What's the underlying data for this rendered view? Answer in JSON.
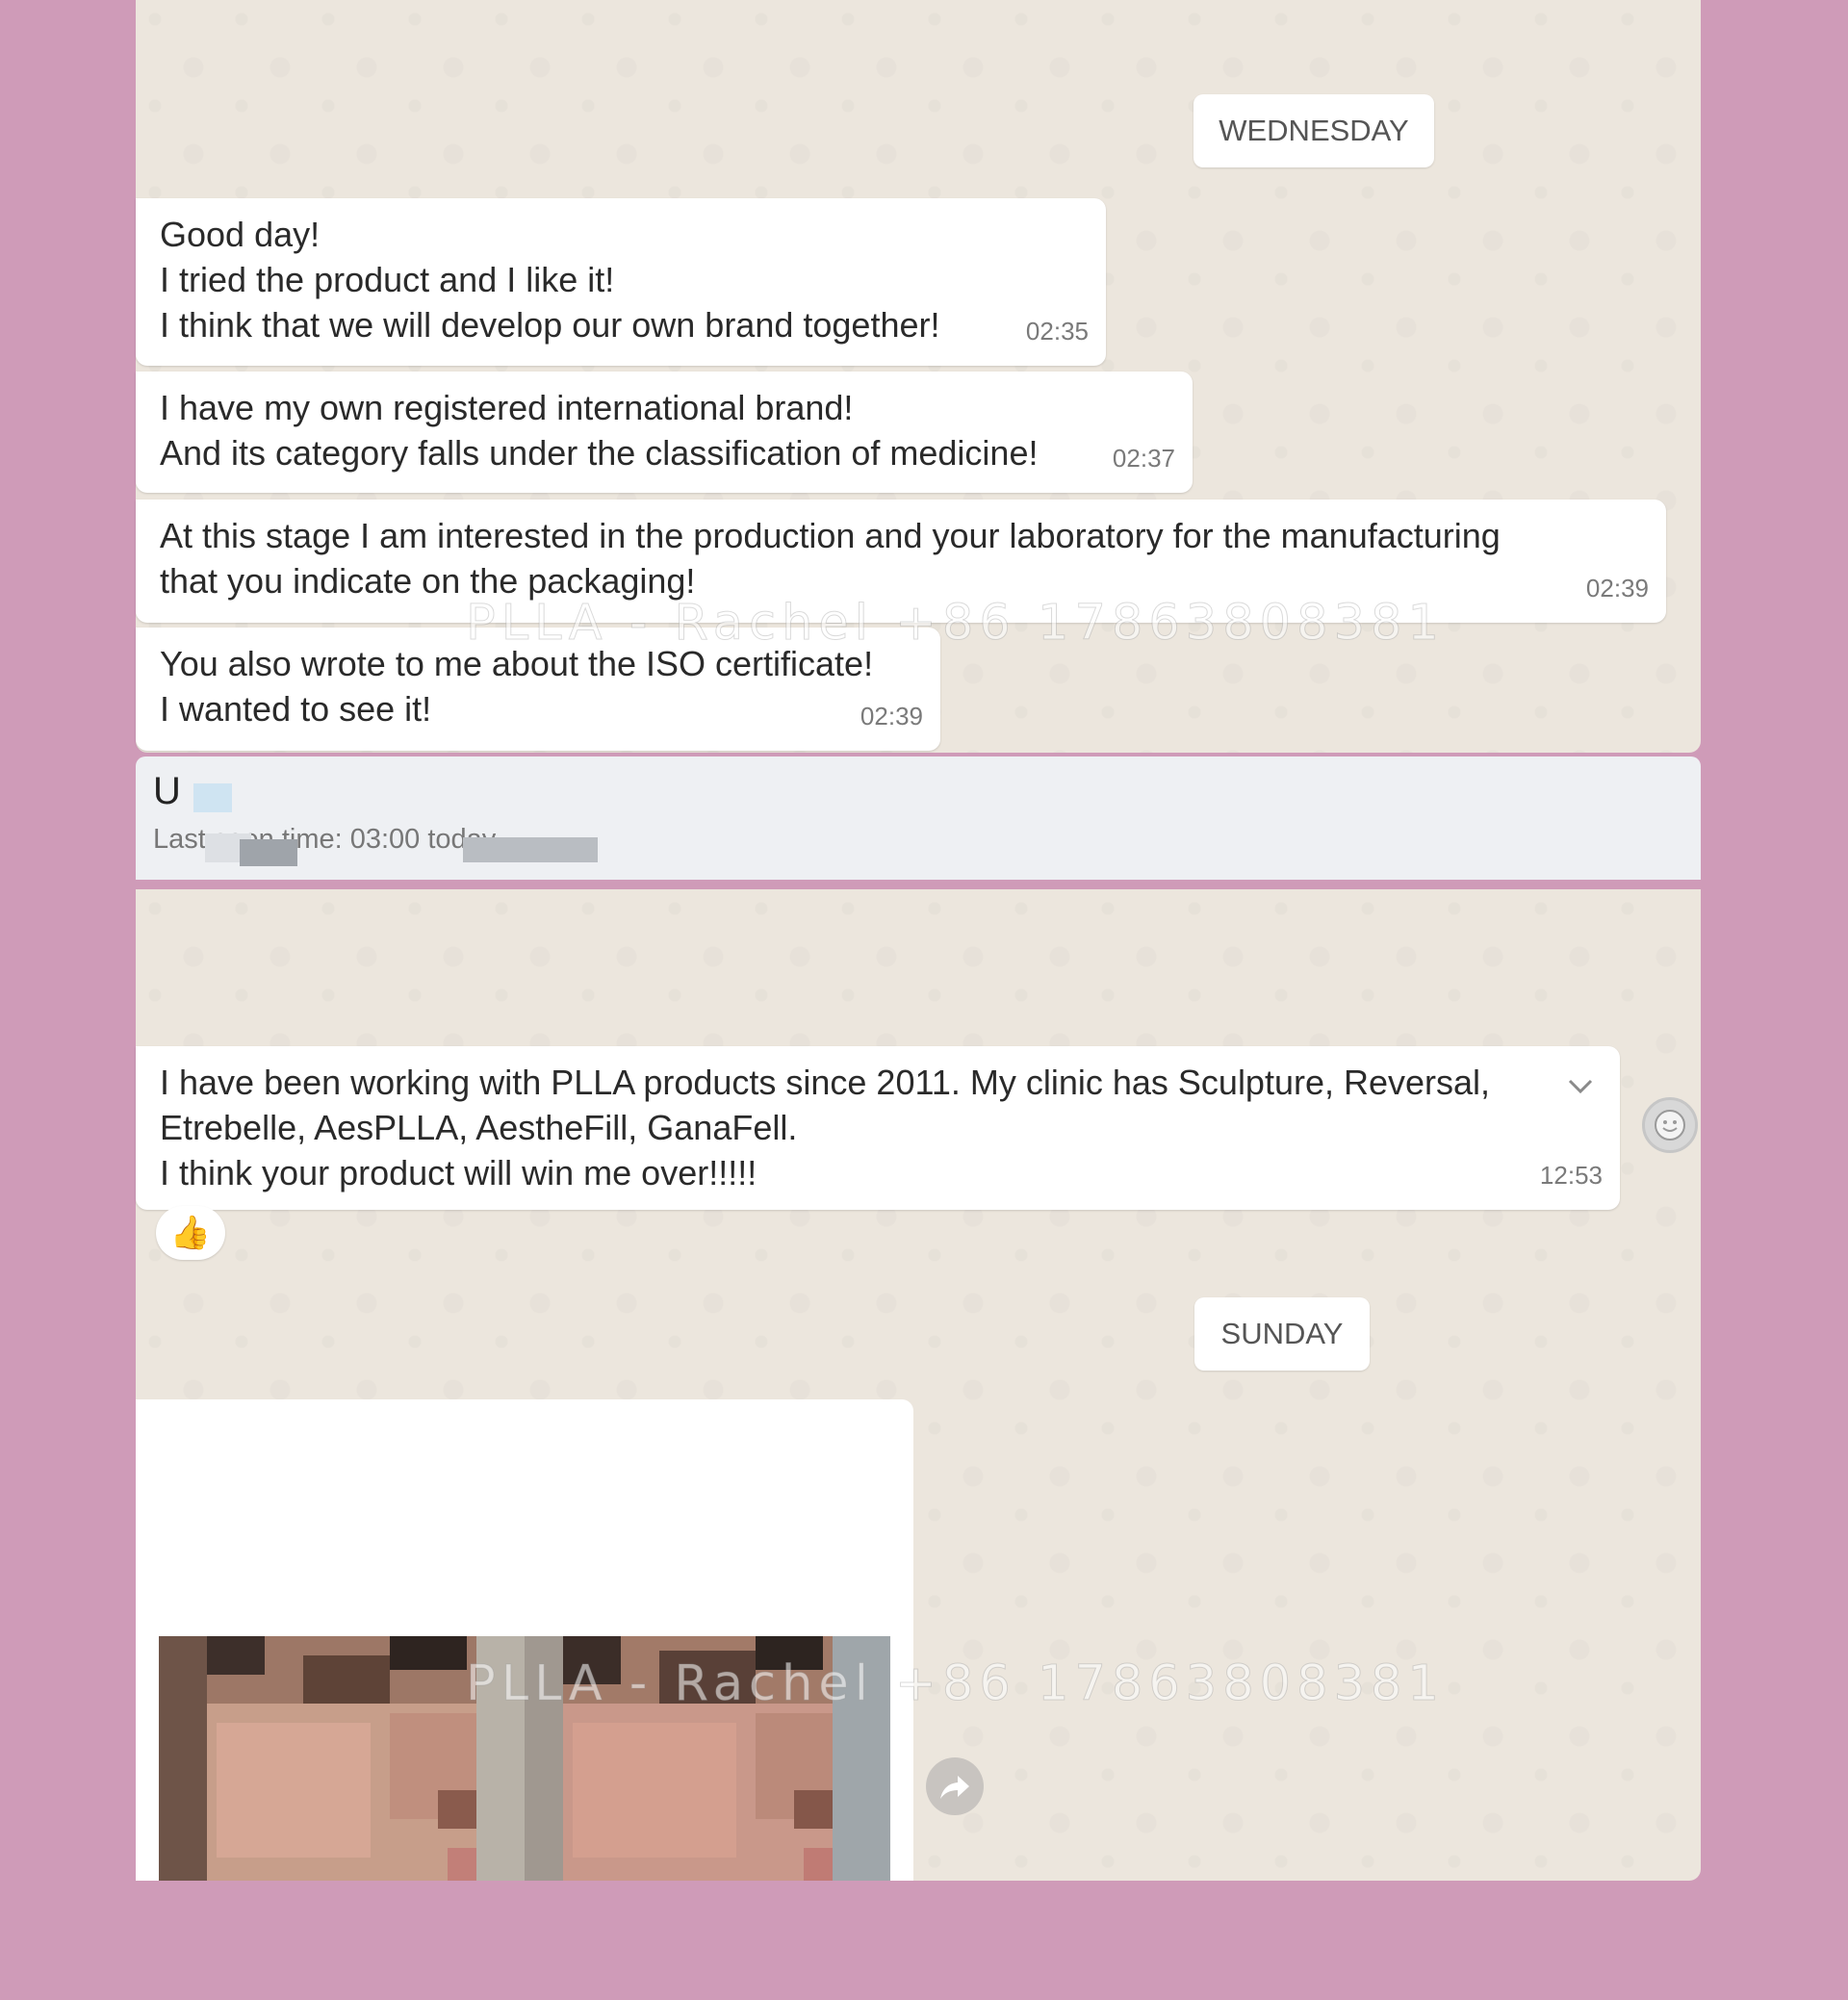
{
  "chat": {
    "day_wednesday": "WEDNESDAY",
    "day_sunday": "SUNDAY",
    "messages": [
      {
        "lines": [
          "Good day!",
          "I tried the product and I like it!",
          "I think that we will develop our own brand together!"
        ],
        "time": "02:35"
      },
      {
        "lines": [
          "I have my own registered international brand!",
          "And its category falls under the classification of medicine!"
        ],
        "time": "02:37"
      },
      {
        "lines": [
          "At this stage I am interested in the production and your laboratory for the manufacturing",
          "that you indicate on the packaging!"
        ],
        "time": "02:39"
      },
      {
        "lines": [
          "You also wrote to me about the ISO certificate!",
          "I wanted to see it!"
        ],
        "time": "02:39"
      },
      {
        "lines": [
          "I have been working with PLLA products since 2011. My clinic has Sculpture, Reversal,",
          "Etrebelle, AesPLLA, AestheFill, GanaFell.",
          "I think your product will win me over!!!!!"
        ],
        "time": "12:53",
        "reaction": "👍"
      }
    ]
  },
  "contact_header": {
    "name": "U",
    "status": "Last seen time: 03:00 today"
  },
  "watermark": "PLLA - Rachel +86 17863808381",
  "icons": {
    "menu": "chevron-down-icon",
    "emoji": "smiley-icon",
    "forward": "forward-icon",
    "reaction": "thumbs-up-icon"
  },
  "colors": {
    "page_background": "#cf9bb8",
    "chat_background": "#ece6dd",
    "bubble": "#ffffff"
  }
}
